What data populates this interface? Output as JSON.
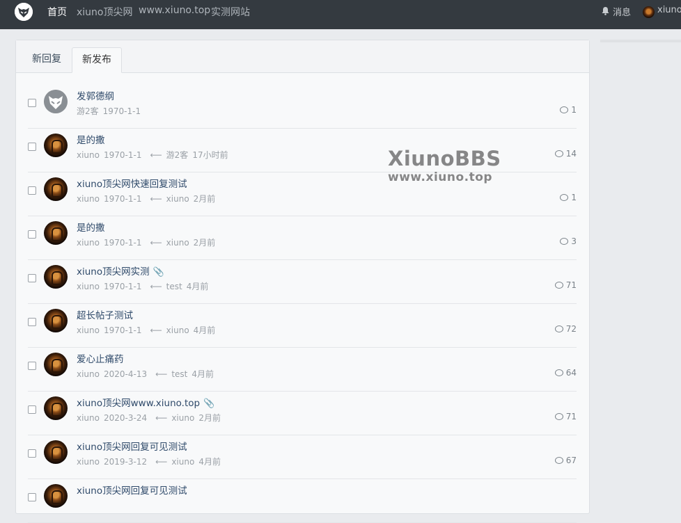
{
  "nav": {
    "links": [
      "首页",
      "xiuno顶尖网",
      "www.xiuno.top",
      "实测网站"
    ],
    "messages_label": "消息",
    "username": "xiuno"
  },
  "tabs": [
    "新回复",
    "新发布"
  ],
  "active_tab": "新发布",
  "threads": [
    {
      "subject": "发郭德纲",
      "author": "游2客",
      "date": "1970-1-1",
      "last_user": "",
      "last_time": "",
      "replies": "1",
      "avatar": "logo",
      "attach": false
    },
    {
      "subject": "是的撒",
      "author": "xiuno",
      "date": "1970-1-1",
      "last_user": "游2客",
      "last_time": "17小时前",
      "replies": "14",
      "avatar": "dark",
      "attach": false
    },
    {
      "subject": "xiuno顶尖网快速回复测试",
      "author": "xiuno",
      "date": "1970-1-1",
      "last_user": "xiuno",
      "last_time": "2月前",
      "replies": "1",
      "avatar": "dark",
      "attach": false
    },
    {
      "subject": "是的撒",
      "author": "xiuno",
      "date": "1970-1-1",
      "last_user": "xiuno",
      "last_time": "2月前",
      "replies": "3",
      "avatar": "dark",
      "attach": false
    },
    {
      "subject": "xiuno顶尖网实测",
      "author": "xiuno",
      "date": "1970-1-1",
      "last_user": "test",
      "last_time": "4月前",
      "replies": "71",
      "avatar": "dark",
      "attach": true
    },
    {
      "subject": "超长帖子测试",
      "author": "xiuno",
      "date": "1970-1-1",
      "last_user": "xiuno",
      "last_time": "4月前",
      "replies": "72",
      "avatar": "dark",
      "attach": false
    },
    {
      "subject": "爱心止痛药",
      "author": "xiuno",
      "date": "2020-4-13",
      "last_user": "test",
      "last_time": "4月前",
      "replies": "64",
      "avatar": "dark",
      "attach": false
    },
    {
      "subject": "xiuno顶尖网www.xiuno.top",
      "author": "xiuno",
      "date": "2020-3-24",
      "last_user": "xiuno",
      "last_time": "2月前",
      "replies": "71",
      "avatar": "dark",
      "attach": true
    },
    {
      "subject": "xiuno顶尖网回复可见测试",
      "author": "xiuno",
      "date": "2019-3-12",
      "last_user": "xiuno",
      "last_time": "4月前",
      "replies": "67",
      "avatar": "dark",
      "attach": false
    },
    {
      "subject": "xiuno顶尖网回复可见测试",
      "author": "",
      "date": "",
      "last_user": "",
      "last_time": "",
      "replies": "",
      "avatar": "dark",
      "attach": false
    }
  ],
  "watermark": {
    "line1": "XiunoBBS",
    "line2": "www.xiuno.top"
  },
  "icons": {
    "logo": "fox-logo-icon",
    "bell": "bell-icon",
    "reply": "comment-icon",
    "attach": "paperclip-icon",
    "arrow": "left-arrow-icon"
  }
}
